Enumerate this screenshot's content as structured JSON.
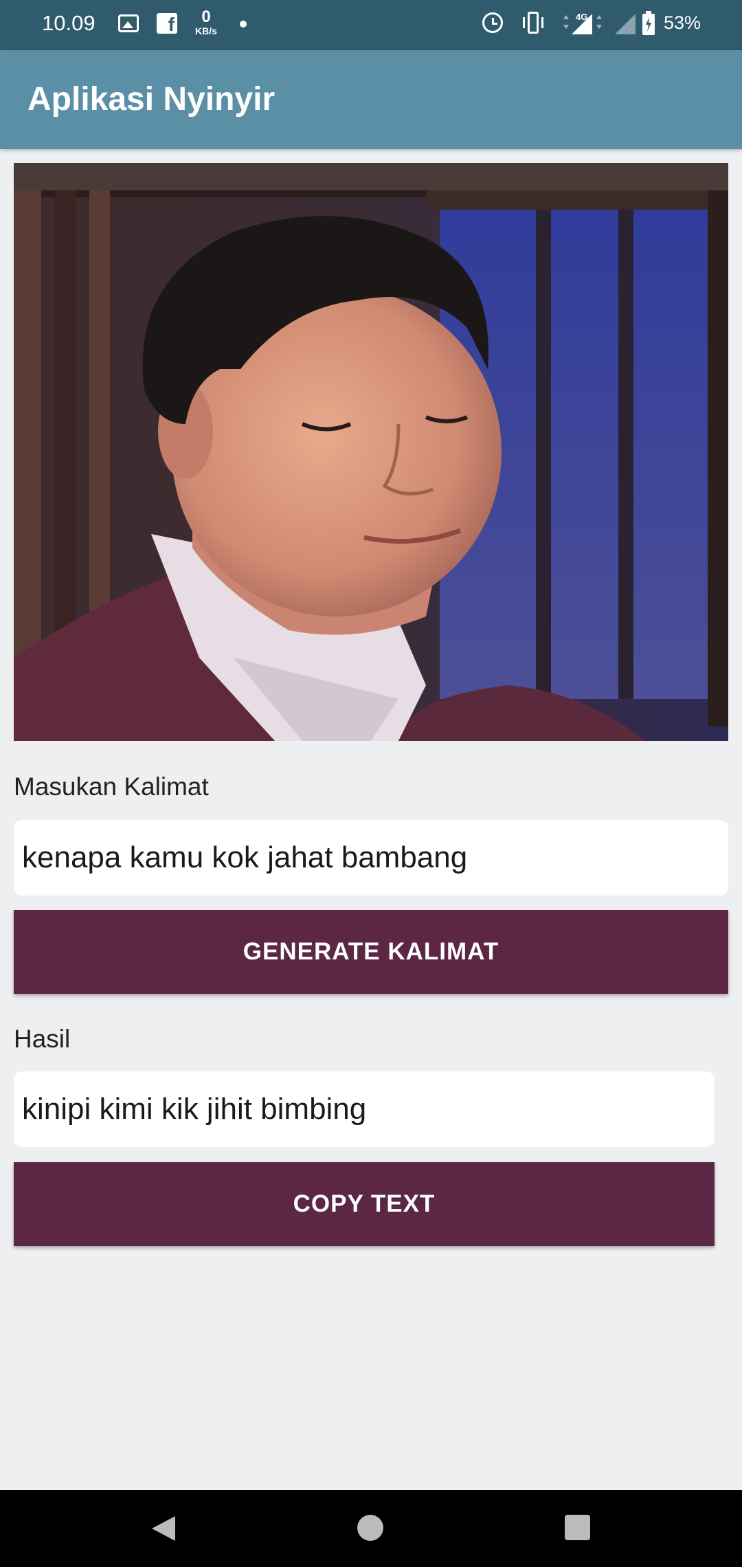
{
  "status_bar": {
    "time": "10.09",
    "net_speed_value": "0",
    "net_speed_unit": "KB/s",
    "network_type": "4G",
    "battery": "53%"
  },
  "app_bar": {
    "title": "Aplikasi Nyinyir"
  },
  "form": {
    "input_label": "Masukan Kalimat",
    "input_value": "kenapa kamu kok jahat bambang",
    "generate_label": "GENERATE KALIMAT",
    "result_label": "Hasil",
    "result_value": "kinipi kimi kik jihit bimbing",
    "copy_label": "COPY TEXT"
  },
  "colors": {
    "status_bar": "#2f5b6d",
    "app_bar": "#5a8fa6",
    "button": "#5b2744",
    "background": "#eeeff1"
  },
  "icons": [
    "gallery-icon",
    "facebook-icon",
    "alarm-icon",
    "vibrate-icon",
    "signal-icon",
    "battery-icon",
    "back-icon",
    "home-icon",
    "recents-icon"
  ]
}
